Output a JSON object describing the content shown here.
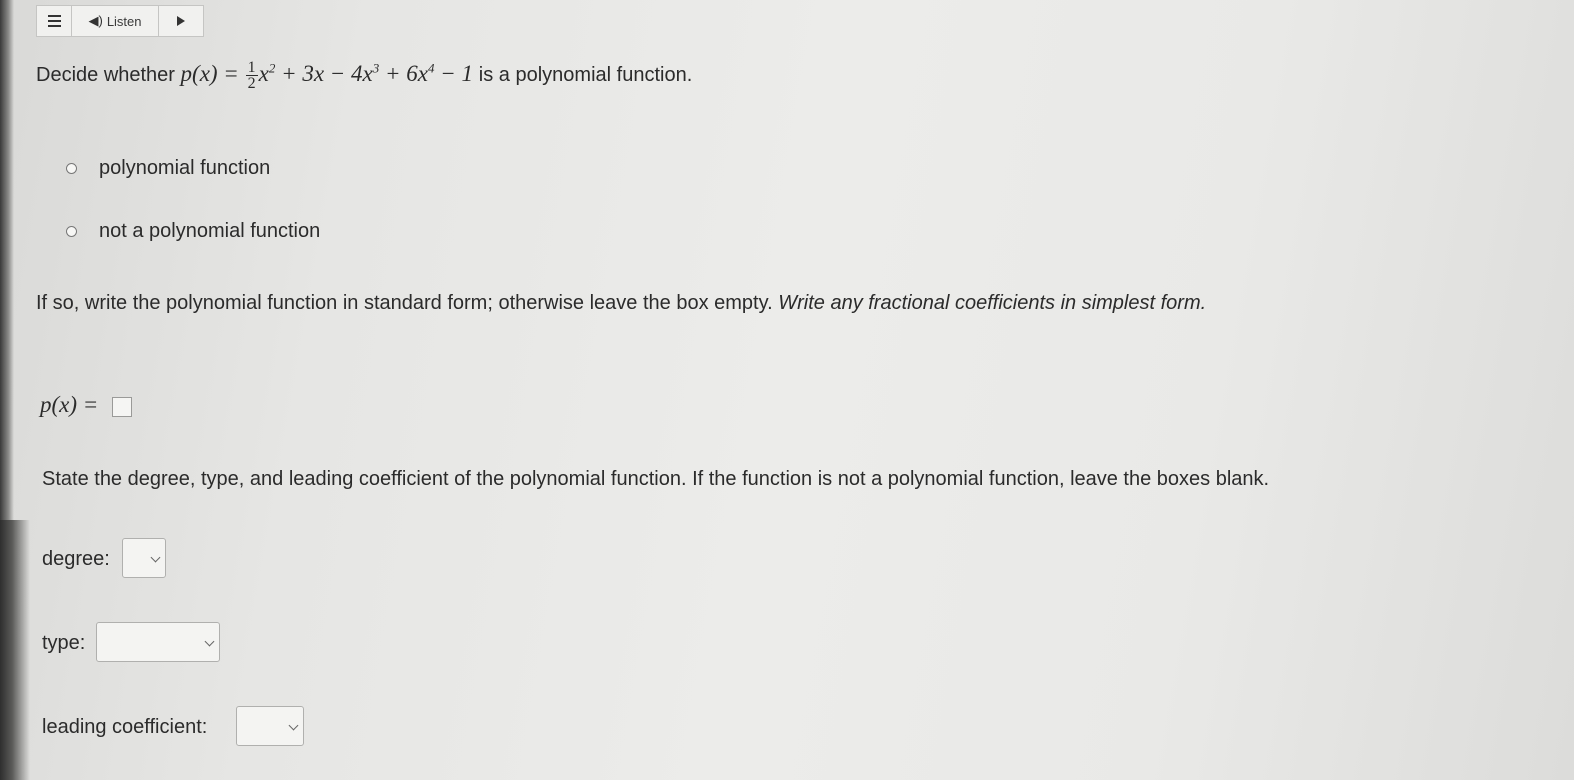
{
  "toolbar": {
    "listen_label": "Listen",
    "menu_icon": "hamburger-icon",
    "speaker_icon": "speaker-icon",
    "play_icon": "play-icon"
  },
  "question": {
    "prefix": "Decide whether",
    "function_lhs": "p(x) =",
    "frac_num": "1",
    "frac_den": "2",
    "term1": "x",
    "term1_exp": "2",
    "term2": "+ 3x − 4x",
    "term2_exp": "3",
    "term3": "+ 6x",
    "term3_exp": "4",
    "term4": "− 1",
    "suffix": "is a polynomial function."
  },
  "choices": [
    {
      "label": "polynomial function",
      "selected": false
    },
    {
      "label": "not a polynomial function",
      "selected": false
    }
  ],
  "instruction": {
    "plain": "If so, write the polynomial function in standard form; otherwise leave the box empty.",
    "italic": "Write any fractional coefficients in simplest form."
  },
  "answer": {
    "lhs": "p(x) =",
    "value": ""
  },
  "state_instruction": "State the degree, type, and leading coefficient of the polynomial function. If the function is not a polynomial function, leave the boxes blank.",
  "fields": {
    "degree_label": "degree:",
    "degree_value": "",
    "type_label": "type:",
    "type_value": "",
    "leading_label": "leading coefficient:",
    "leading_value": ""
  },
  "colors": {
    "text": "#2b2b2b",
    "background": "#ececea",
    "border": "#b0b0ae"
  }
}
